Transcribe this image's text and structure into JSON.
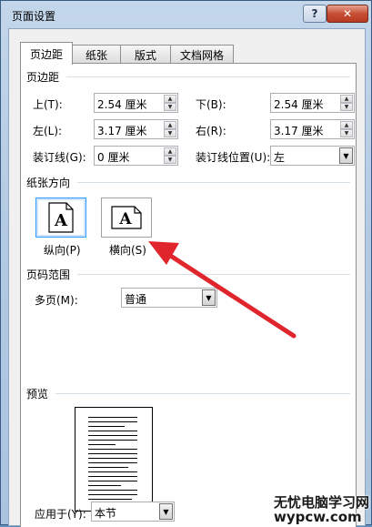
{
  "window": {
    "title": "页面设置",
    "help_glyph": "?",
    "close_glyph": "✕"
  },
  "tabs": [
    {
      "label": "页边距",
      "active": true
    },
    {
      "label": "纸张",
      "active": false
    },
    {
      "label": "版式",
      "active": false
    },
    {
      "label": "文档网格",
      "active": false
    }
  ],
  "margins": {
    "section_title": "页边距",
    "top": {
      "label": "上(T):",
      "value": "2.54 厘米"
    },
    "bottom": {
      "label": "下(B):",
      "value": "2.54 厘米"
    },
    "left": {
      "label": "左(L):",
      "value": "3.17 厘米"
    },
    "right": {
      "label": "右(R):",
      "value": "3.17 厘米"
    },
    "gutter": {
      "label": "装订线(G):",
      "value": "0 厘米"
    },
    "gutter_position": {
      "label": "装订线位置(U):",
      "value": "左"
    }
  },
  "orientation": {
    "section_title": "纸张方向",
    "portrait": {
      "label": "纵向(P)",
      "glyph": "A",
      "selected": true
    },
    "landscape": {
      "label": "横向(S)",
      "glyph": "A",
      "selected": false
    }
  },
  "pages": {
    "section_title": "页码范围",
    "multiple_label": "多页(M):",
    "multiple_value": "普通"
  },
  "preview": {
    "section_title": "预览"
  },
  "apply": {
    "label": "应用于(Y):",
    "value": "本节"
  },
  "watermark": {
    "line1": "无忧电脑学习网",
    "line2": "wypcw.com"
  },
  "colors": {
    "annotation_arrow": "#e0262c",
    "selection": "#3399ff"
  }
}
